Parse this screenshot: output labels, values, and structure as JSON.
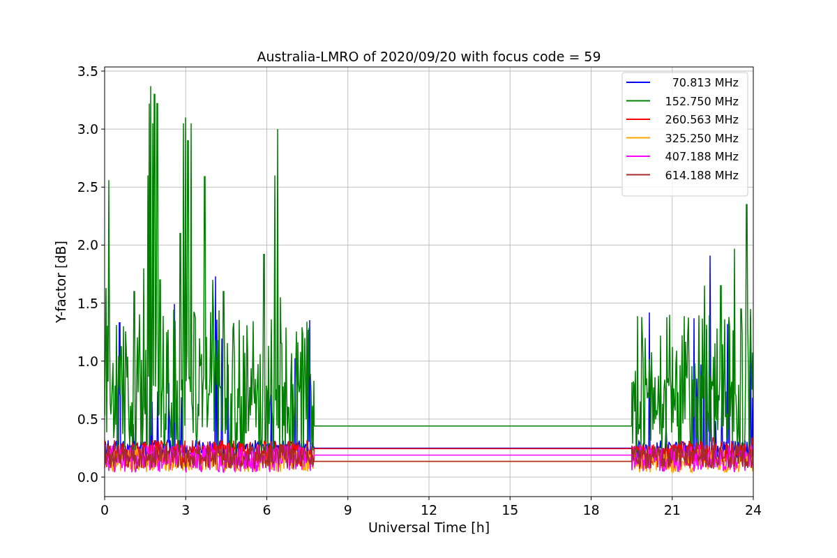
{
  "chart": {
    "title": "Australia-LMRO of 2020/09/20 with focus code = 59",
    "xlabel": "Universal Time [h]",
    "ylabel": "Y-factor [dB]",
    "xticks": [
      "0",
      "3",
      "6",
      "9",
      "12",
      "15",
      "18",
      "21",
      "24"
    ],
    "yticks": [
      "3.5",
      "3.0",
      "2.5",
      "2.0",
      "1.5",
      "1.0",
      "0.5",
      "0.0"
    ],
    "legend": [
      {
        "label": "70.813 MHz",
        "color": "#0000ff"
      },
      {
        "label": "152.750 MHz",
        "color": "#008000"
      },
      {
        "label": "260.563 MHz",
        "color": "#ff0000"
      },
      {
        "label": "325.250 MHz",
        "color": "#ffa500"
      },
      {
        "label": "407.188 MHz",
        "color": "#ff00ff"
      },
      {
        "label": "614.188 MHz",
        "color": "#a52a2a"
      }
    ]
  }
}
